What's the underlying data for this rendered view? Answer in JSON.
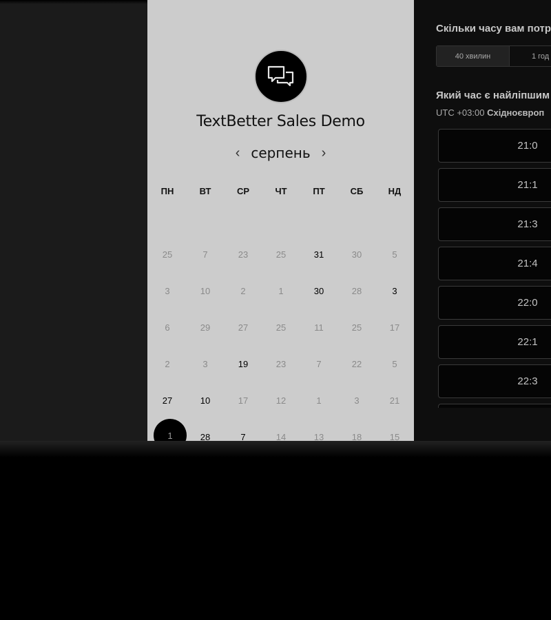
{
  "calendar": {
    "title": "TextBetter Sales Demo",
    "month": "серпень",
    "prev_icon": "‹",
    "next_icon": "›",
    "weekdays": [
      "ПН",
      "ВТ",
      "СР",
      "ЧТ",
      "ПТ",
      "СБ",
      "НД"
    ],
    "weeks": [
      [
        {
          "d": "25",
          "a": false
        },
        {
          "d": "7",
          "a": false
        },
        {
          "d": "23",
          "a": false
        },
        {
          "d": "25",
          "a": false
        },
        {
          "d": "31",
          "a": true
        },
        {
          "d": "30",
          "a": false
        },
        {
          "d": "5",
          "a": false
        }
      ],
      [
        {
          "d": "3",
          "a": false
        },
        {
          "d": "10",
          "a": false
        },
        {
          "d": "2",
          "a": false
        },
        {
          "d": "1",
          "a": false
        },
        {
          "d": "30",
          "a": true
        },
        {
          "d": "28",
          "a": false
        },
        {
          "d": "3",
          "a": true
        }
      ],
      [
        {
          "d": "6",
          "a": false
        },
        {
          "d": "29",
          "a": false
        },
        {
          "d": "27",
          "a": false
        },
        {
          "d": "25",
          "a": false
        },
        {
          "d": "11",
          "a": false
        },
        {
          "d": "25",
          "a": false
        },
        {
          "d": "17",
          "a": false
        }
      ],
      [
        {
          "d": "2",
          "a": false
        },
        {
          "d": "3",
          "a": false
        },
        {
          "d": "19",
          "a": true
        },
        {
          "d": "23",
          "a": false
        },
        {
          "d": "7",
          "a": false
        },
        {
          "d": "22",
          "a": false
        },
        {
          "d": "5",
          "a": false
        }
      ],
      [
        {
          "d": "27",
          "a": true
        },
        {
          "d": "10",
          "a": true
        },
        {
          "d": "17",
          "a": false
        },
        {
          "d": "12",
          "a": false
        },
        {
          "d": "1",
          "a": false
        },
        {
          "d": "3",
          "a": false
        },
        {
          "d": "21",
          "a": false
        }
      ],
      [
        {
          "d": "1",
          "a": true,
          "selected": true
        },
        {
          "d": "28",
          "a": true
        },
        {
          "d": "7",
          "a": true
        },
        {
          "d": "14",
          "a": false
        },
        {
          "d": "13",
          "a": false
        },
        {
          "d": "18",
          "a": false
        },
        {
          "d": "15",
          "a": false
        }
      ]
    ]
  },
  "booking": {
    "duration_question": "Скільки часу вам потр",
    "durations": [
      "40 хвилин",
      "1 год"
    ],
    "time_question": "Який час є найліпшим",
    "timezone_prefix": "UTC +03:00",
    "timezone_name": "Східноєвроп",
    "slots": [
      "21:0",
      "21:1",
      "21:3",
      "21:4",
      "22:0",
      "22:1",
      "22:3",
      ""
    ]
  }
}
